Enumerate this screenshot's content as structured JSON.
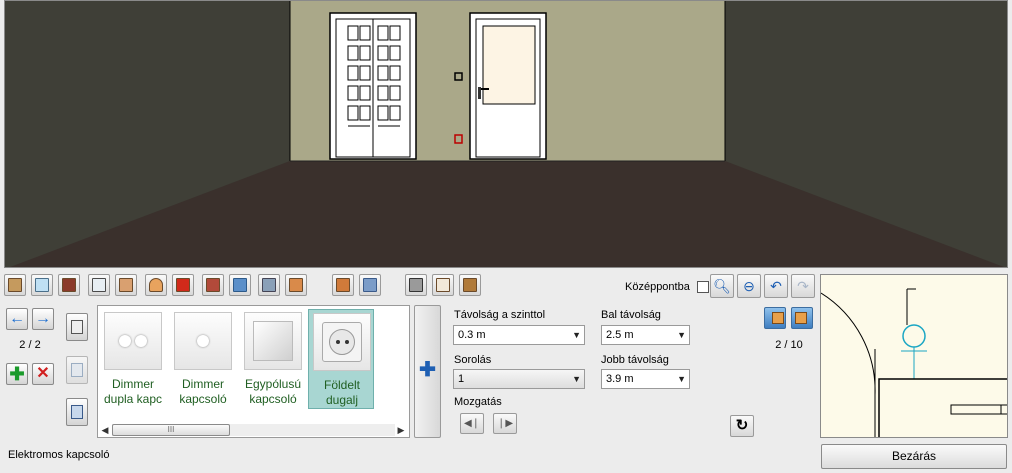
{
  "toolbar": {
    "tools": [
      "door-icon",
      "window-icon",
      "colored-door-icon",
      "double-window-icon",
      "radiator-icon",
      "ceiling-lamp-icon",
      "wall-lamp-icon",
      "picture-icon",
      "floor-tile-icon",
      "floor-tile2-icon",
      "floor-tile3-icon",
      "wall-tile-icon",
      "wall-tile2-icon",
      "appliance-icon",
      "faucet-icon",
      "cabinet-icon"
    ],
    "center_label": "Középpontba",
    "center_checked": false
  },
  "nav": {
    "page_counter": "2 / 2",
    "prev_icon": "arrow-left-icon",
    "next_icon": "arrow-right-icon",
    "add_icon": "green-plus-icon",
    "delete_icon": "red-x-icon"
  },
  "catalog": {
    "items": [
      {
        "label_line1": "Dimmer",
        "label_line2": "dupla kapc",
        "icon": "double-dimmer-icon",
        "selected": false
      },
      {
        "label_line1": "Dimmer",
        "label_line2": "kapcsoló",
        "icon": "dimmer-icon",
        "selected": false
      },
      {
        "label_line1": "Egypólusú",
        "label_line2": "kapcsoló",
        "icon": "single-switch-icon",
        "selected": false
      },
      {
        "label_line1": "Földelt",
        "label_line2": "dugalj",
        "icon": "grounded-socket-icon",
        "selected": true
      }
    ],
    "scroll_grip": "III"
  },
  "properties": {
    "floor_distance_label": "Távolság a szinttol",
    "floor_distance_value": "0.3 m",
    "left_distance_label": "Bal távolság",
    "left_distance_value": "2.5 m",
    "row_label": "Sorolás",
    "row_value": "1",
    "right_distance_label": "Jobb távolság",
    "right_distance_value": "3.9 m",
    "movement_label": "Mozgatás"
  },
  "variants": {
    "counter": "2 / 10"
  },
  "status_text": "Elektromos kapcsoló",
  "close_label": "Bezárás",
  "colors": {
    "wall": "#aaa889",
    "floor": "#3a302c",
    "side_wall": "#3f3f37",
    "selected": "#a8d6d2",
    "label_green": "#205f22"
  }
}
